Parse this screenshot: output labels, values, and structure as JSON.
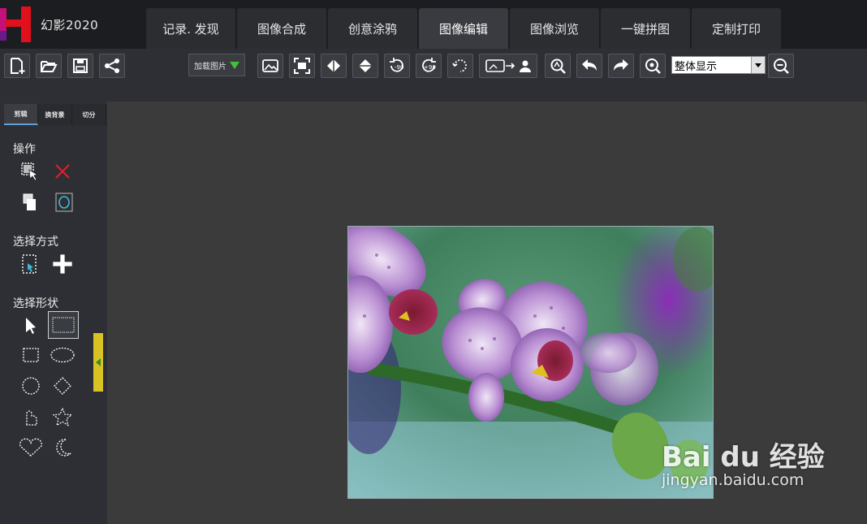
{
  "app": {
    "name": "幻影2020"
  },
  "tabs": [
    {
      "label": "记录. 发现",
      "active": false
    },
    {
      "label": "图像合成",
      "active": false
    },
    {
      "label": "创意涂鸦",
      "active": false
    },
    {
      "label": "图像编辑",
      "active": true
    },
    {
      "label": "图像浏览",
      "active": false
    },
    {
      "label": "一键拼图",
      "active": false
    },
    {
      "label": "定制打印",
      "active": false
    }
  ],
  "toolbar": {
    "load_label": "加载图片",
    "zoom_selected": "整体显示"
  },
  "left_panel": {
    "tabs": [
      "剪辑",
      "换背景",
      "切分"
    ],
    "section_operation": "操作",
    "section_select_mode": "选择方式",
    "section_select_shape": "选择形状"
  },
  "watermark": {
    "brand": "Bai du 经验",
    "url": "jingyan.baidu.com"
  },
  "colors": {
    "accent_red": "#e0101c",
    "active_tab": "#3a3b40",
    "handle": "#d9c224"
  }
}
